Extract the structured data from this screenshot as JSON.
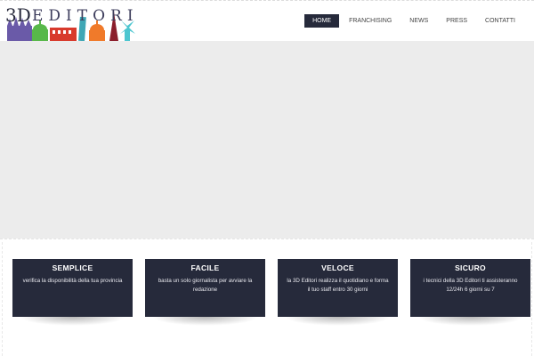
{
  "logo": {
    "prefix": "3D",
    "text": "EDITORI",
    "alt_icon": "city-skyline-logo"
  },
  "nav": {
    "items": [
      {
        "label": "HOME",
        "active": true
      },
      {
        "label": "FRANCHISING",
        "active": false
      },
      {
        "label": "NEWS",
        "active": false
      },
      {
        "label": "PRESS",
        "active": false
      },
      {
        "label": "CONTATTI",
        "active": false
      }
    ]
  },
  "features": [
    {
      "title": "SEMPLICE",
      "text": "verifica la disponibilità della tua provincia"
    },
    {
      "title": "FACILE",
      "text": "basta un solo giornalista per avviare la redazione"
    },
    {
      "title": "VELOCE",
      "text": "la 3D Editori realizza il quotidiano e forma il tuo staff entro 30 giorni"
    },
    {
      "title": "SICURO",
      "text": "i tecnici della 3D Editori ti assisteranno 12/24h 6 giorni su 7"
    }
  ],
  "colors": {
    "card_bg": "#262a3b",
    "nav_active_bg": "#262a3b",
    "hero_bg": "#ececec"
  }
}
